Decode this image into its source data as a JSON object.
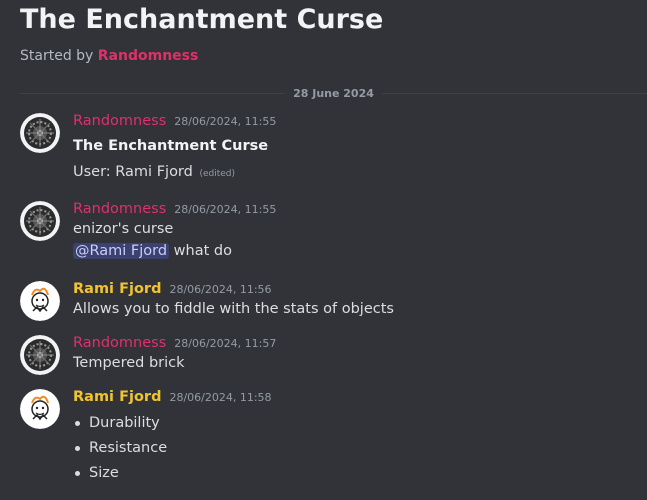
{
  "thread": {
    "title": "The Enchantment Curse",
    "started_prefix": "Started by",
    "started_by": "Randomness"
  },
  "date_divider": "28 June 2024",
  "messages": [
    {
      "author": "Randomness",
      "time": "28/06/2024, 11:55",
      "line1": "The Enchantment Curse",
      "line2": "User: Rami Fjord",
      "edited": "(edited)"
    },
    {
      "author": "Randomness",
      "time": "28/06/2024, 11:55",
      "line1": "enizor's curse",
      "mention": "@Rami Fjord",
      "line2_rest": "what do"
    },
    {
      "author": "Rami Fjord",
      "time": "28/06/2024, 11:56",
      "line1": "Allows you to fiddle with the stats of objects"
    },
    {
      "author": "Randomness",
      "time": "28/06/2024, 11:57",
      "line1": "Tempered brick"
    },
    {
      "author": "Rami Fjord",
      "time": "28/06/2024, 11:58",
      "bullets": [
        "Durability",
        "Resistance",
        "Size"
      ]
    }
  ],
  "colors": {
    "background": "#313338",
    "randomness": "#e0306a",
    "rami": "#f0c330",
    "mention_bg": "#3c4270"
  },
  "icons": {
    "randomness_avatar": "clockwork-gear-avatar",
    "rami_avatar": "cartoon-character-avatar"
  }
}
